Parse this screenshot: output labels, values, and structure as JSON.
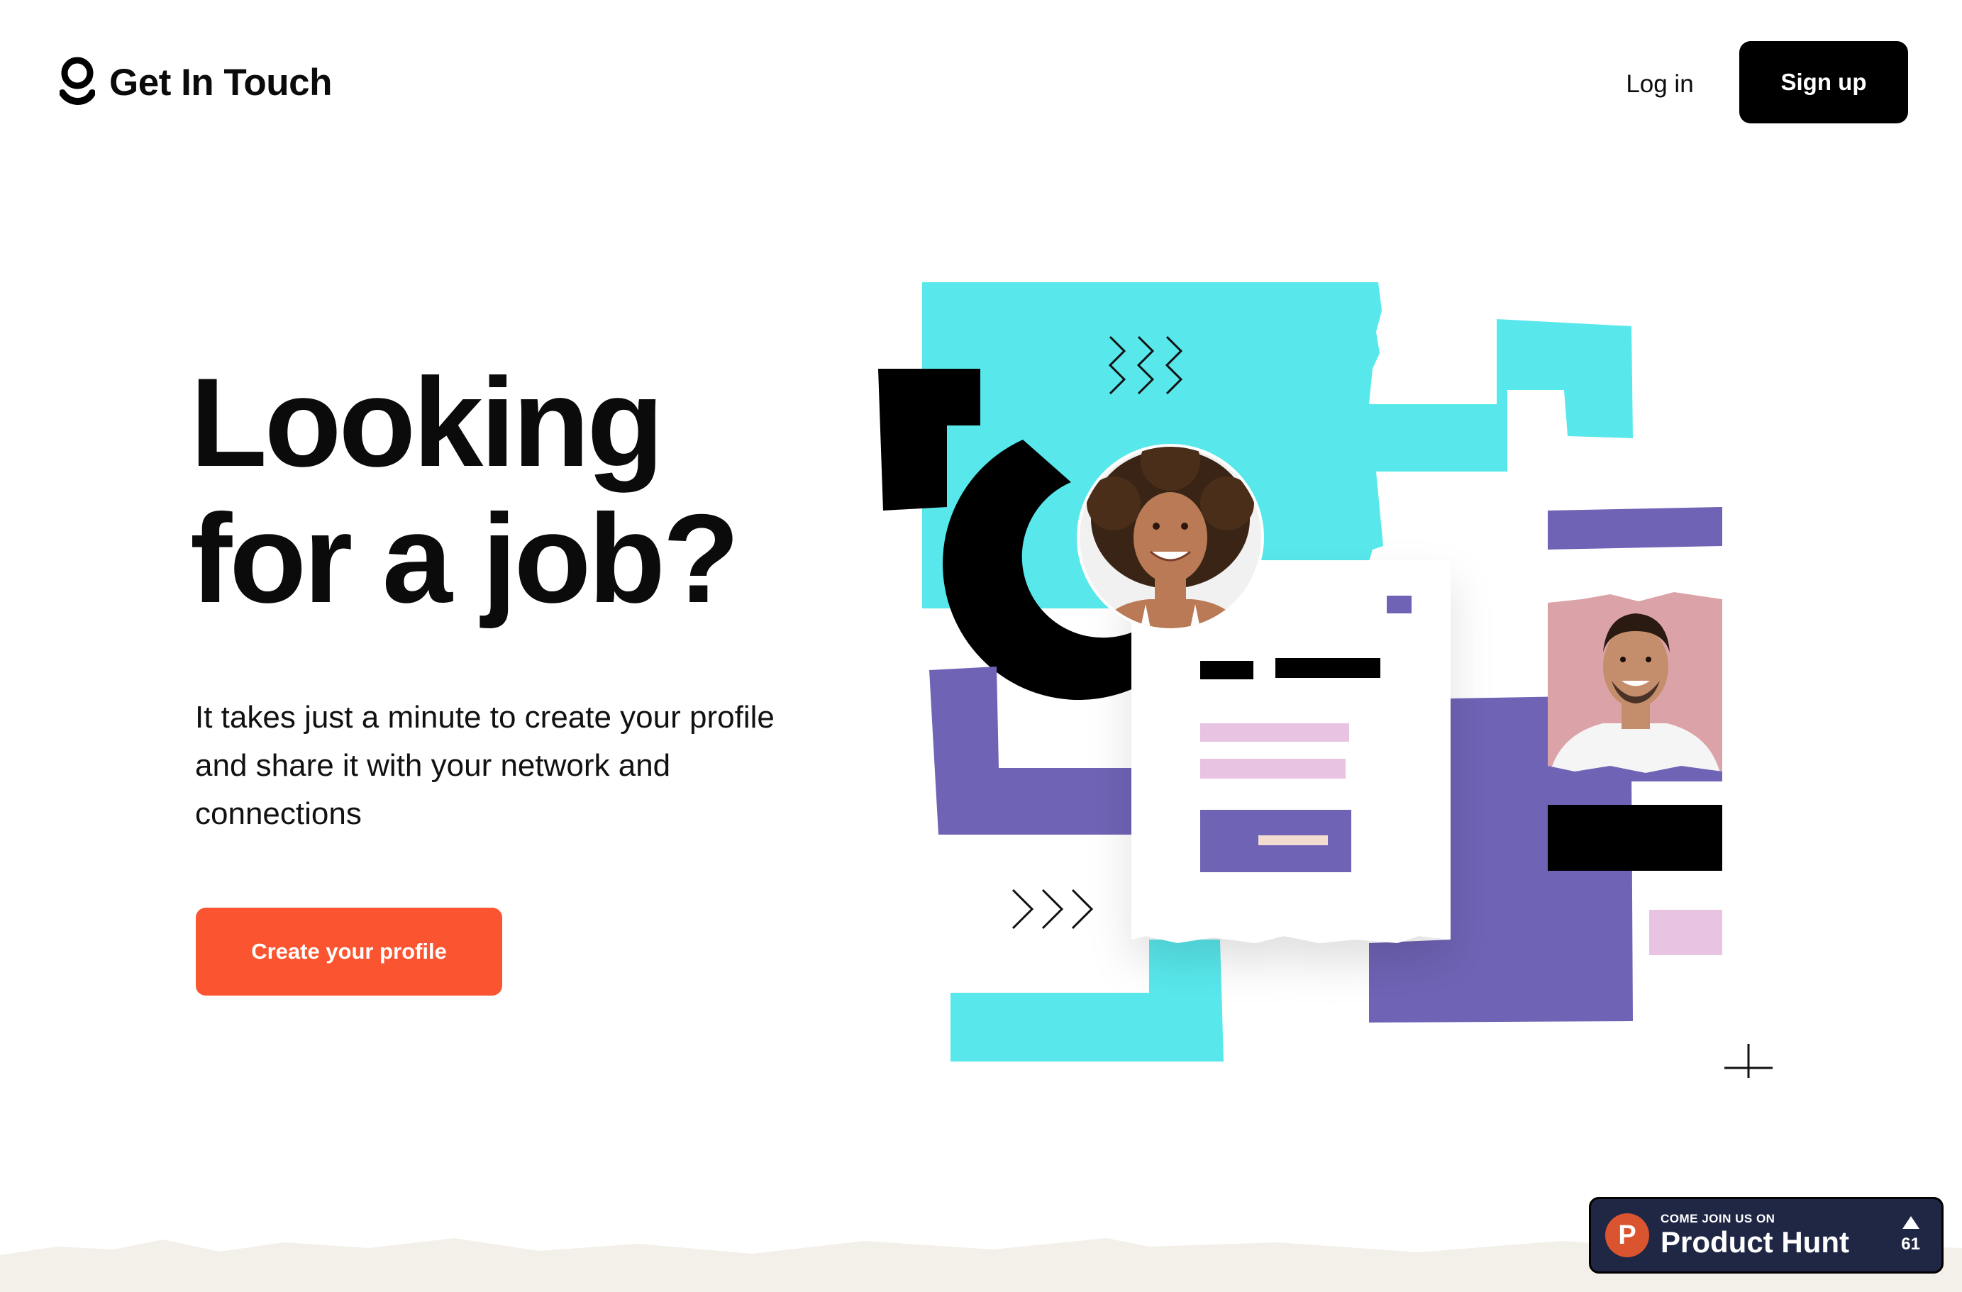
{
  "header": {
    "logo_text": "Get In Touch",
    "login_label": "Log in",
    "signup_label": "Sign up"
  },
  "hero": {
    "title_line1": "Looking",
    "title_line2": "for a job?",
    "subtitle": "It takes just a minute to create your profile and share it with your network and connections",
    "cta_label": "Create your profile"
  },
  "colors": {
    "accent": "#fa5530",
    "cyan": "#58e8ec",
    "purple": "#6e63b5",
    "pink": "#e8c4e2",
    "rose": "#dba3a8",
    "black": "#000000"
  },
  "product_hunt": {
    "kicker": "COME JOIN US ON",
    "name": "Product Hunt",
    "logo_letter": "P",
    "votes": "61"
  }
}
